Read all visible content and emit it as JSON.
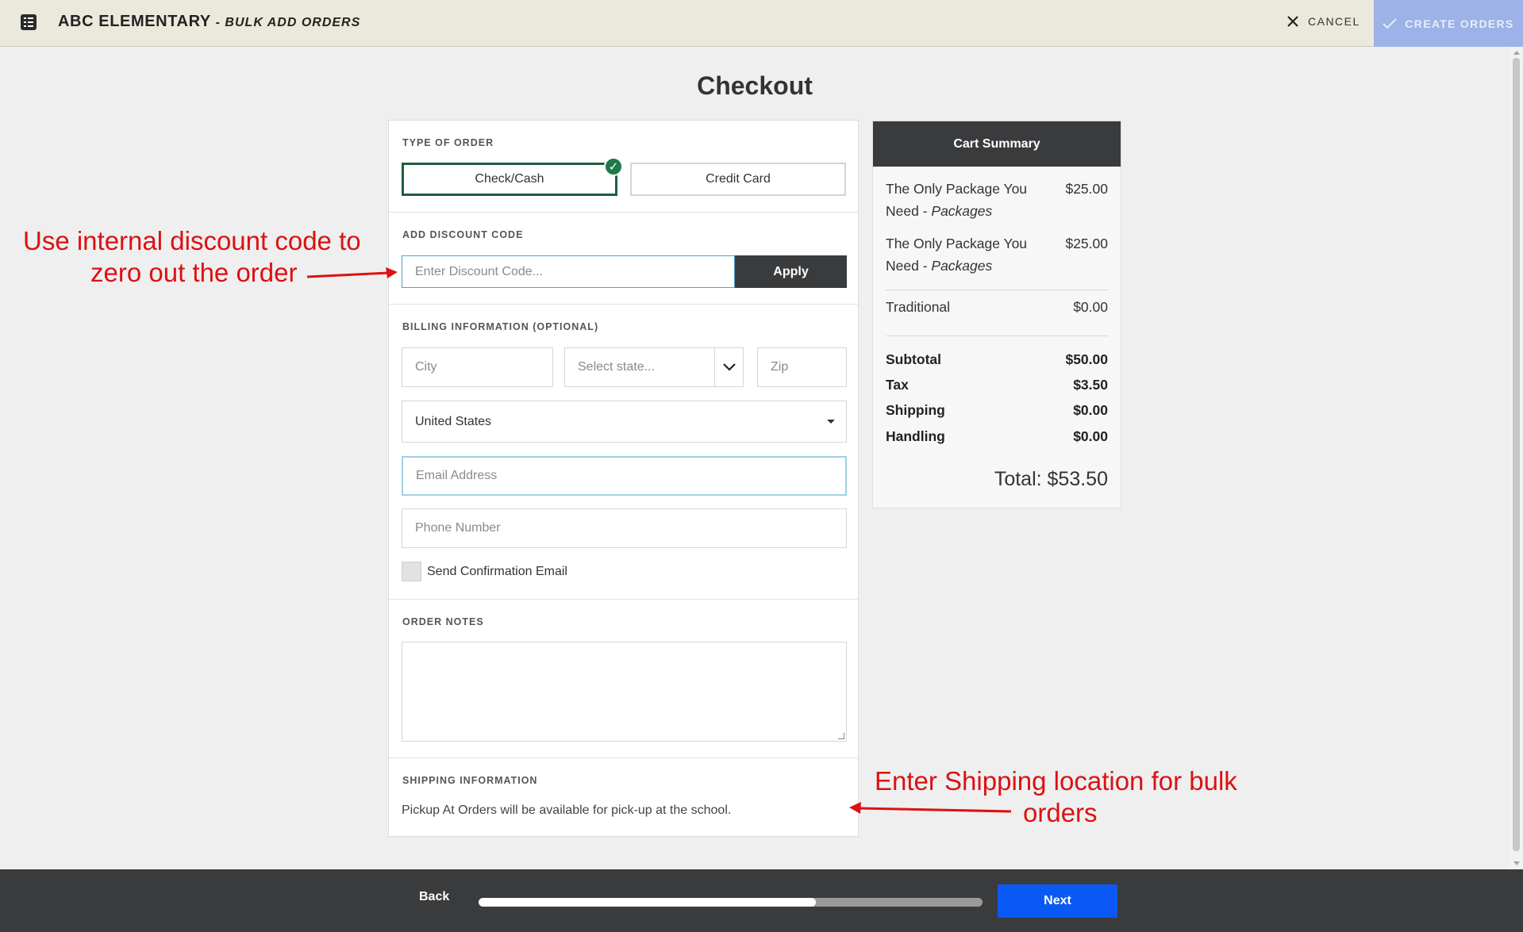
{
  "header": {
    "title": "ABC ELEMENTARY",
    "subtitle": "- BULK ADD ORDERS",
    "cancel_label": "CANCEL",
    "create_label": "CREATE ORDERS",
    "icons": {
      "app": "document-list-icon",
      "cancel": "close-icon",
      "create": "check-icon"
    }
  },
  "page": {
    "heading": "Checkout"
  },
  "order_type": {
    "label": "TYPE OF ORDER",
    "options": [
      "Check/Cash",
      "Credit Card"
    ],
    "selected": "Check/Cash"
  },
  "discount": {
    "label": "ADD DISCOUNT CODE",
    "placeholder": "Enter Discount Code...",
    "apply_label": "Apply"
  },
  "billing": {
    "label": "BILLING INFORMATION (OPTIONAL)",
    "city_placeholder": "City",
    "state_placeholder": "Select state...",
    "zip_placeholder": "Zip",
    "country_value": "United States",
    "email_placeholder": "Email Address",
    "phone_placeholder": "Phone Number",
    "confirm_label": "Send Confirmation Email",
    "confirm_checked": false
  },
  "notes": {
    "label": "ORDER NOTES"
  },
  "shipping": {
    "label": "SHIPPING INFORMATION",
    "text": "Pickup At Orders will be available for pick-up at the school."
  },
  "cart": {
    "title": "Cart Summary",
    "items": [
      {
        "name": "The Only Package You Need",
        "suffix": "Packages",
        "price": "$25.00"
      },
      {
        "name": "The Only Package You Need",
        "suffix": "Packages",
        "price": "$25.00"
      }
    ],
    "extra": {
      "name": "Traditional",
      "price": "$0.00"
    },
    "totals": [
      {
        "label": "Subtotal",
        "value": "$50.00"
      },
      {
        "label": "Tax",
        "value": "$3.50"
      },
      {
        "label": "Shipping",
        "value": "$0.00"
      },
      {
        "label": "Handling",
        "value": "$0.00"
      }
    ],
    "grand_total": "Total: $53.50"
  },
  "annotations": {
    "discount_line1": "Use internal discount code to",
    "discount_line2": "zero out the order",
    "shipping_line1": "Enter Shipping location for bulk",
    "shipping_line2": "orders"
  },
  "footer": {
    "back_label": "Back",
    "next_label": "Next",
    "progress": 0.67
  },
  "colors": {
    "accent_selected": "#1e5e3d",
    "check_badge": "#1e7a4b",
    "next_button": "#0a59f5",
    "annotation": "#dd1111",
    "dark": "#3a3b3d"
  }
}
